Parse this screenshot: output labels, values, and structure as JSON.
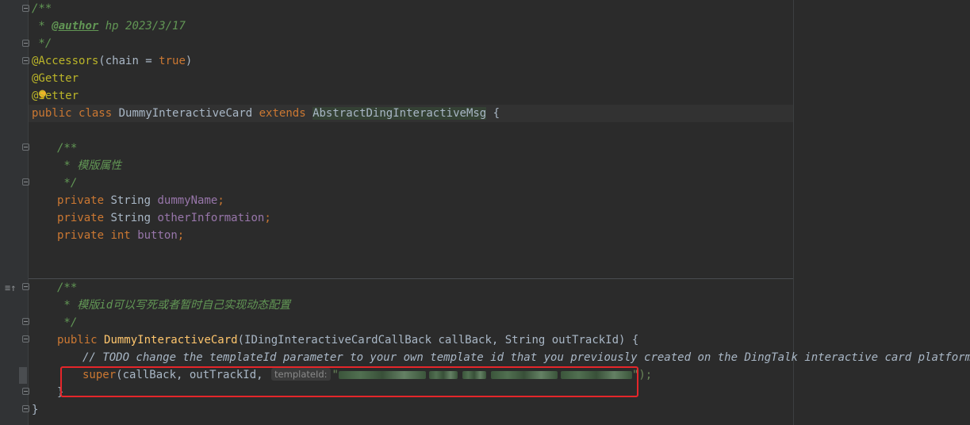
{
  "editor": {
    "javadoc_open": "/**",
    "author_prefix": " * ",
    "author_tag": "@author",
    "author_value": " hp 2023/3/17",
    "javadoc_close": " */",
    "ann_accessors": "@Accessors",
    "accessors_args_open": "(chain = ",
    "accessors_true": "true",
    "accessors_args_close": ")",
    "ann_getter": "@Getter",
    "ann_setter": "@Setter",
    "kw_public": "public",
    "kw_class": "class",
    "class_name": "DummyInteractiveCard",
    "kw_extends": "extends",
    "super_class": "AbstractDingInteractiveMsg",
    "open_brace": " {",
    "doc1_open": "/**",
    "doc1_text": " * 模版属性",
    "doc1_close": " */",
    "kw_private": "private",
    "type_string": "String",
    "type_int": "int",
    "field1": "dummyName",
    "field2": "otherInformation",
    "field3": "button",
    "semicolon": ";",
    "doc2_open": "/**",
    "doc2_text": " * 模版id可以写死或者暂时自己实现动态配置",
    "doc2_close": " */",
    "ctor_name": "DummyInteractiveCard",
    "ctor_params": "(IDingInteractiveCardCallBack callBack, String outTrackId) {",
    "todo_comment": "// TODO change the templateId parameter to your own template id that you previously created on the DingTalk interactive card platform.",
    "super_kw": "super",
    "super_args": "(callBack, outTrackId, ",
    "param_hint": "templateId:",
    "string_quote": "\"",
    "super_close": "\");",
    "close_ctor": "}",
    "close_class": "}"
  },
  "colors": {
    "background": "#2b2b2b",
    "keyword": "#cc7832",
    "annotation": "#bbb529",
    "comment": "#629755",
    "field": "#9876aa",
    "method": "#ffc66d",
    "highlight_box": "#e5262a"
  },
  "icons": [
    "fold-icon",
    "implements-icon",
    "intention-bulb-icon"
  ]
}
